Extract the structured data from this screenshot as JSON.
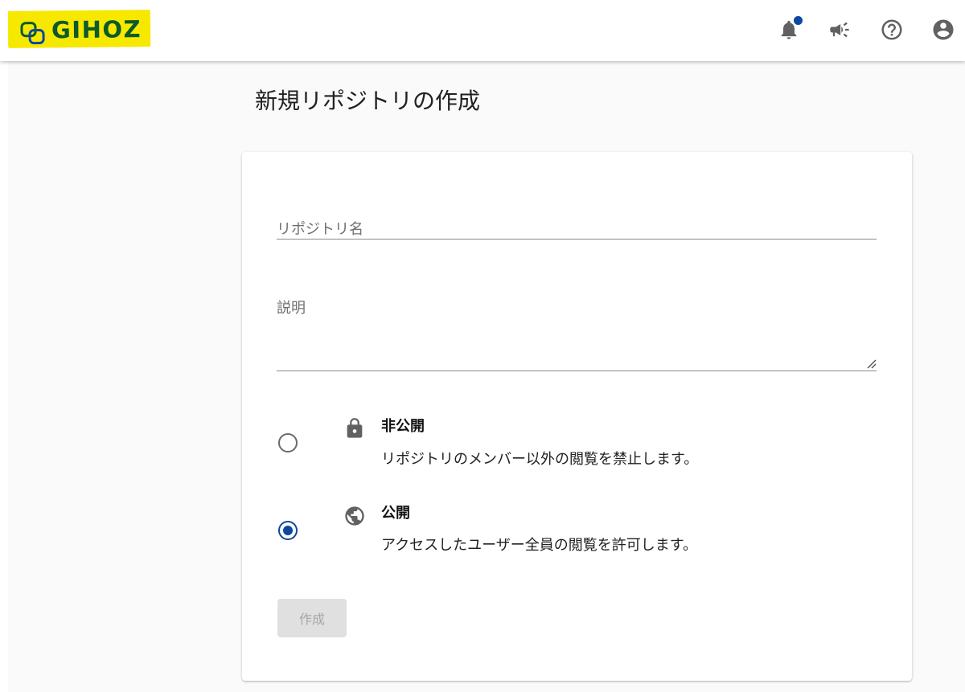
{
  "header": {
    "logo_text": "GIHOZ",
    "icons": [
      "bell-icon",
      "megaphone-icon",
      "help-circle-icon",
      "account-circle-icon"
    ]
  },
  "page": {
    "title": "新規リポジトリの作成"
  },
  "form": {
    "name_placeholder": "リポジトリ名",
    "name_value": "",
    "description_placeholder": "説明",
    "description_value": "",
    "visibility": {
      "selected": "public",
      "options": [
        {
          "id": "private",
          "icon": "lock-icon",
          "title": "非公開",
          "description": "リポジトリのメンバー以外の閲覧を禁止します。"
        },
        {
          "id": "public",
          "icon": "globe-icon",
          "title": "公開",
          "description": "アクセスしたユーザー全員の閲覧を許可します。"
        }
      ]
    },
    "submit_label": "作成",
    "submit_disabled": true
  },
  "colors": {
    "logo_highlight": "#f7e800",
    "logo_text": "#0b5a2a",
    "accent": "#0d47a1",
    "page_background": "#fafafa",
    "disabled_button": "#e0e0e0"
  }
}
